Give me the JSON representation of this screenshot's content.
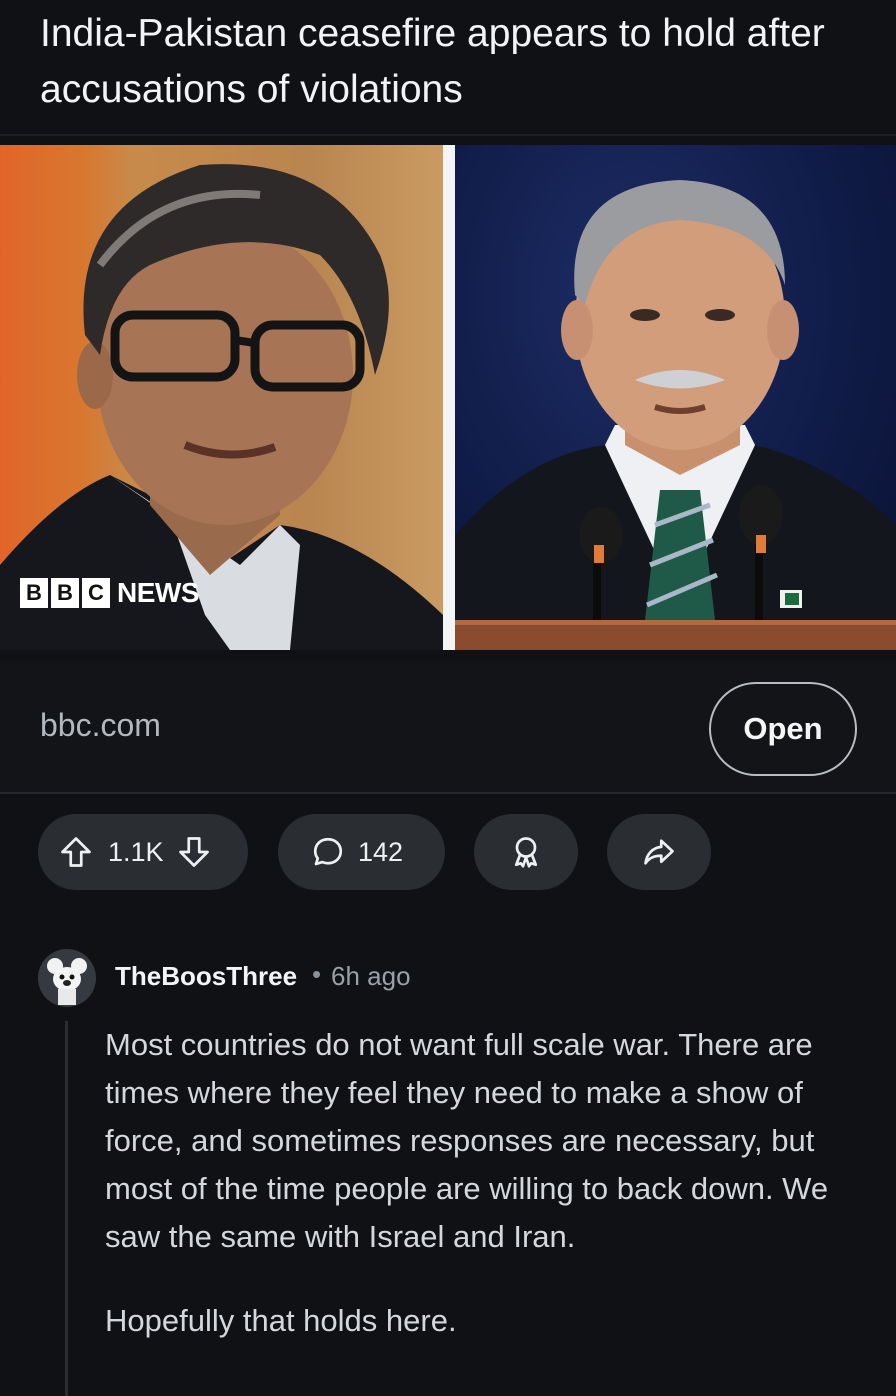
{
  "post": {
    "title": "India-Pakistan ceasefire appears to hold after accusations of violations",
    "image": {
      "watermark_blocks": [
        "B",
        "B",
        "C"
      ],
      "watermark_word": "NEWS"
    }
  },
  "link": {
    "domain": "bbc.com",
    "open_label": "Open"
  },
  "actions": {
    "score": "1.1K",
    "comment_count": "142",
    "upvote_icon": "arrow-up-icon",
    "downvote_icon": "arrow-down-icon",
    "comment_icon": "speech-bubble-icon",
    "award_icon": "award-icon",
    "share_icon": "share-arrow-icon"
  },
  "comment": {
    "author": "TheBoosThree",
    "separator": "•",
    "time": "6h ago",
    "paragraphs": [
      "Most countries do not want full scale war. There are times where they feel they need to make a show of force, and sometimes responses are necessary, but most of the time people are willing to back down. We saw the same with Israel and Iran.",
      "Hopefully that holds here."
    ]
  },
  "colors": {
    "background": "#0f1114",
    "pill": "#2a2d32",
    "text": "#e6e8ea",
    "muted": "#9aa0a7"
  }
}
